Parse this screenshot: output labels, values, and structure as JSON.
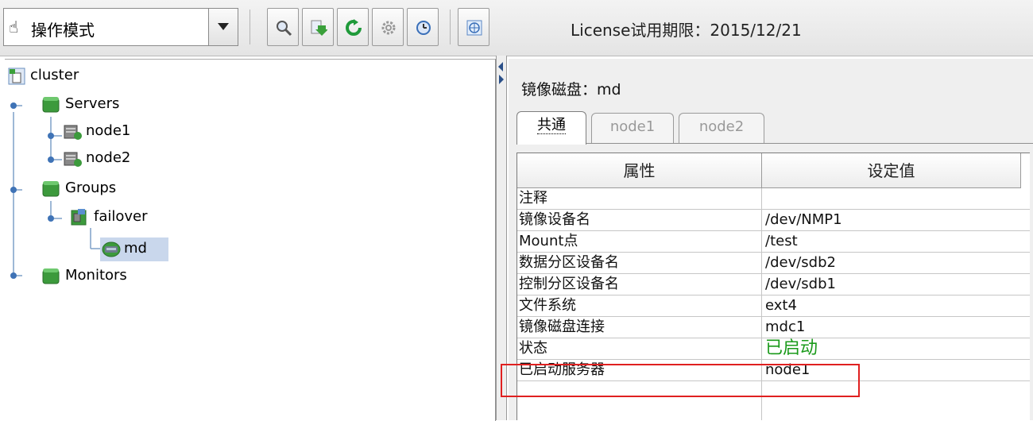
{
  "toolbar": {
    "mode_label": "操作模式",
    "license_text": "License试用期限：2015/12/21",
    "buttons": [
      {
        "name": "search-button",
        "icon": "magnifier-icon"
      },
      {
        "name": "import-button",
        "icon": "download-arrow-icon"
      },
      {
        "name": "refresh-button",
        "icon": "refresh-icon"
      },
      {
        "name": "settings-button",
        "icon": "gear-icon"
      },
      {
        "name": "clock-button",
        "icon": "clock-icon"
      },
      {
        "name": "globe-button",
        "icon": "globe-icon"
      }
    ]
  },
  "tree": {
    "root": "cluster",
    "servers": "Servers",
    "node1": "node1",
    "node2": "node2",
    "groups": "Groups",
    "failover": "failover",
    "md": "md",
    "monitors": "Monitors"
  },
  "detail": {
    "title": "镜像磁盘：md",
    "tabs": [
      "共通",
      "node1",
      "node2"
    ],
    "active_tab": "共通",
    "headers": {
      "property": "属性",
      "value": "设定值"
    },
    "rows": [
      {
        "property": "注释",
        "value": ""
      },
      {
        "property": "镜像设备名",
        "value": "/dev/NMP1"
      },
      {
        "property": "Mount点",
        "value": "/test"
      },
      {
        "property": "数据分区设备名",
        "value": "/dev/sdb2"
      },
      {
        "property": "控制分区设备名",
        "value": "/dev/sdb1"
      },
      {
        "property": "文件系统",
        "value": "ext4"
      },
      {
        "property": "镜像磁盘连接",
        "value": "mdc1"
      },
      {
        "property": "状态",
        "value": "已启动"
      },
      {
        "property": "已启动服务器",
        "value": "node1"
      }
    ]
  },
  "colors": {
    "status_value": "#1a9a1a",
    "highlight_box": "#e02020",
    "selection": "#c9d7ec",
    "server_green": "#3c9a3c"
  }
}
